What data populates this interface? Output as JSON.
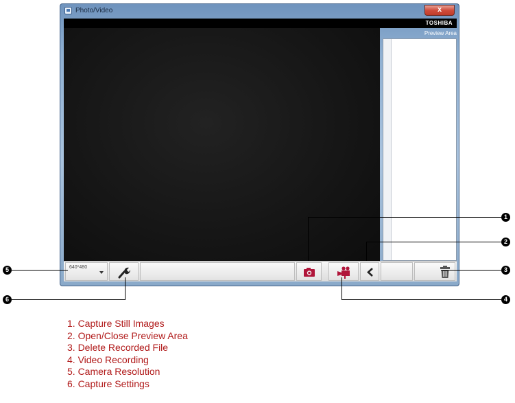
{
  "window": {
    "title": "Photo/Video",
    "close_label": "x",
    "brand": "TOSHIBA",
    "preview_label": "Preview Area"
  },
  "toolbar": {
    "resolution_value": "640*480",
    "icons": {
      "settings": "wrench-icon",
      "capture": "camera-icon",
      "record": "video-camera-icon",
      "toggle_preview": "chevron-left-icon",
      "delete": "trash-icon"
    }
  },
  "callouts": [
    "1",
    "2",
    "3",
    "4",
    "5",
    "6"
  ],
  "legend": [
    "1. Capture Still Images",
    "2. Open/Close Preview Area",
    "3. Delete Recorded File",
    "4. Video Recording",
    "5. Camera Resolution",
    "6. Capture Settings"
  ],
  "colors": {
    "icon_accent": "#b0153a",
    "legend_text": "#b01818",
    "window_frame": "#8fb0d2"
  }
}
